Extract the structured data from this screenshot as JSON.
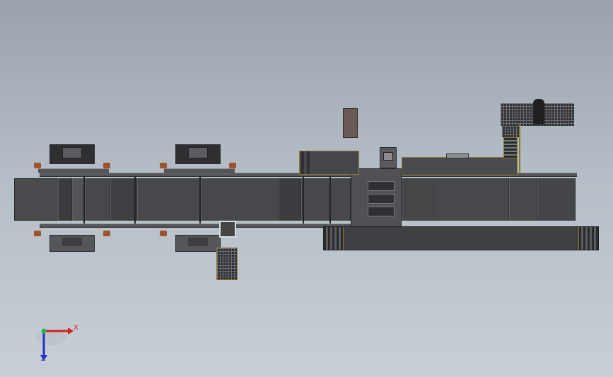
{
  "viewport": {
    "view": "top",
    "background_top": "#9aa3ad",
    "background_bottom": "#c9cfd6"
  },
  "triad": {
    "x_label": "X",
    "z_label": "Z",
    "x_color": "#d21f1f",
    "y_color": "#21b14b",
    "z_color": "#2232c9"
  },
  "model": {
    "body_color": "#3d3e40",
    "edge_color": "#2a2a2c",
    "accent_color": "#8a7a2a",
    "roller_color": "#a0522d"
  }
}
